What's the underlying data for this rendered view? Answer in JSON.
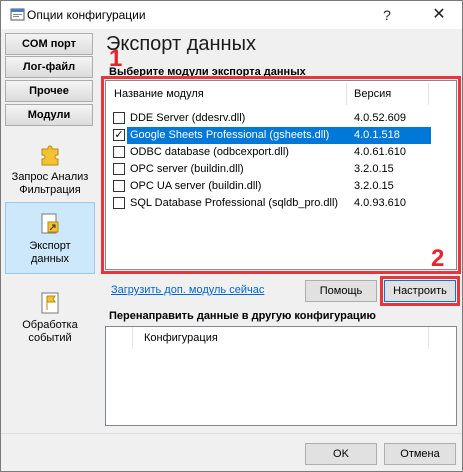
{
  "window": {
    "title": "Опции конфигурации",
    "help_glyph": "?",
    "close_glyph": "✕"
  },
  "sidebar": {
    "buttons": [
      {
        "label": "COM порт"
      },
      {
        "label": "Лог-файл"
      },
      {
        "label": "Прочее"
      },
      {
        "label": "Модули"
      }
    ],
    "items": [
      {
        "label_line1": "Запрос Анализ",
        "label_line2": "Фильтрация",
        "icon": "puzzle-icon"
      },
      {
        "label_line1": "Экспорт",
        "label_line2": "данных",
        "icon": "export-icon"
      },
      {
        "label_line1": "Обработка",
        "label_line2": "событий",
        "icon": "flag-icon"
      }
    ]
  },
  "main": {
    "title": "Экспорт данных",
    "modules_label": "Выберите модули экспорта данных",
    "marker_1": "1",
    "marker_2": "2",
    "columns": {
      "name": "Название модуля",
      "version": "Версия"
    },
    "modules": [
      {
        "name": "DDE Server (ddesrv.dll)",
        "version": "4.0.52.609",
        "checked": false,
        "selected": false
      },
      {
        "name": "Google Sheets Professional (gsheets.dll)",
        "version": "4.0.1.518",
        "checked": true,
        "selected": true
      },
      {
        "name": "ODBC database (odbcexport.dll)",
        "version": "4.0.61.610",
        "checked": false,
        "selected": false
      },
      {
        "name": "OPC server (buildin.dll)",
        "version": "3.2.0.15",
        "checked": false,
        "selected": false
      },
      {
        "name": "OPC UA server (buildin.dll)",
        "version": "3.2.0.15",
        "checked": false,
        "selected": false
      },
      {
        "name": "SQL Database Professional (sqldb_pro.dll)",
        "version": "4.0.93.610",
        "checked": false,
        "selected": false
      }
    ],
    "load_link": "Загрузить доп. модуль сейчас",
    "help_button": "Помощь",
    "configure_button": "Настроить",
    "redirect_label": "Перенаправить данные в другую конфигурацию",
    "config_column": "Конфигурация"
  },
  "footer": {
    "ok": "OK",
    "cancel": "Отмена"
  },
  "colors": {
    "accent": "#0078d7",
    "marker": "#e8232b",
    "link": "#0066cc"
  }
}
